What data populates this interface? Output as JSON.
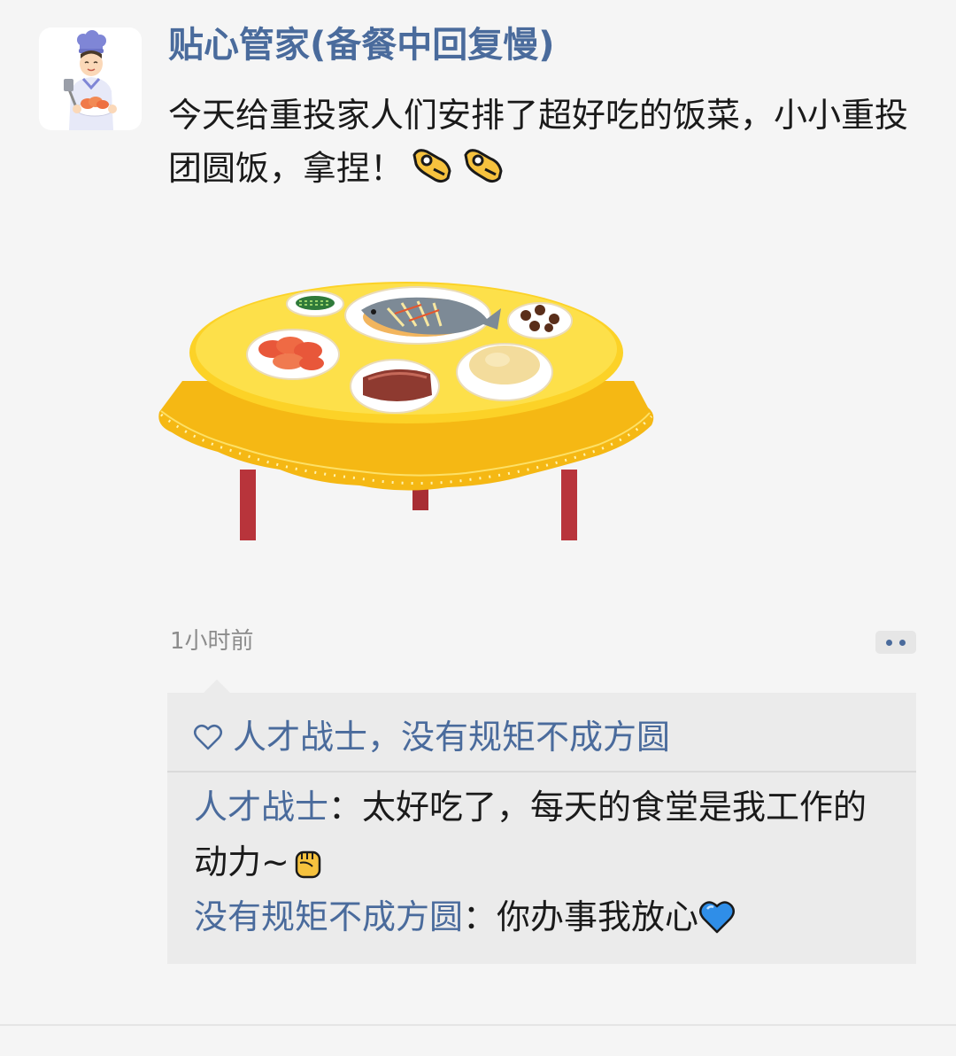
{
  "post": {
    "author": "贴心管家(备餐中回复慢)",
    "text": "今天给重投家人们安排了超好吃的饭菜，小小重投团圆饭，拿捏！",
    "emojis": [
      "ok-hand-pinch-emoji",
      "ok-hand-pinch-emoji"
    ],
    "timestamp": "1小时前",
    "image": "dining-table-illustration"
  },
  "likes": {
    "icon": "heart-outline-icon",
    "names": "人才战士，没有规矩不成方圆"
  },
  "comments": [
    {
      "author": "人才战士",
      "separator": "：",
      "text": "太好吃了，每天的食堂是我工作的动力~",
      "emoji": "raised-fist-emoji"
    },
    {
      "author": "没有规矩不成方圆",
      "separator": "：",
      "text": "你办事我放心",
      "emoji": "blue-heart-emoji"
    }
  ],
  "colors": {
    "background": "#f5f5f5",
    "link_blue": "#4a6b9c",
    "panel": "#ebebeb",
    "text": "#1a1a1a",
    "muted": "#8c8c8c"
  }
}
